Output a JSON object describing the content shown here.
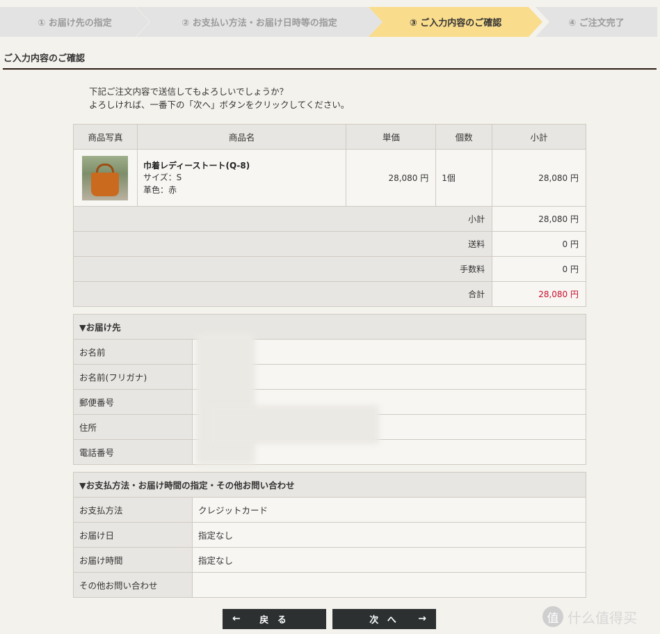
{
  "steps": [
    {
      "label": "① お届け先の指定",
      "active": false
    },
    {
      "label": "② お支払い方法・お届け日時等の指定",
      "active": false
    },
    {
      "label": "③ ご入力内容のご確認",
      "active": true
    },
    {
      "label": "④ ご注文完了",
      "active": false
    }
  ],
  "page_title": "ご入力内容のご確認",
  "intro": {
    "line1": "下記ご注文内容で送信してもよろしいでしょうか？",
    "line2": "よろしければ、一番下の「次へ」ボタンをクリックしてください。"
  },
  "cart": {
    "headers": [
      "商品写真",
      "商品名",
      "単価",
      "個数",
      "小計"
    ],
    "item": {
      "image_alt": "巾着レディーストート",
      "name": "巾着レディーストート(Q-8)",
      "attr_size": "サイズ：S",
      "attr_color": "革色：赤",
      "unit_price": "28,080 円",
      "quantity": "1個",
      "subtotal": "28,080 円"
    },
    "summary": [
      {
        "label": "小計",
        "value": "28,080 円"
      },
      {
        "label": "送料",
        "value": "0 円"
      },
      {
        "label": "手数料",
        "value": "0 円"
      },
      {
        "label": "合計",
        "value": "28,080 円"
      }
    ]
  },
  "shipping": {
    "heading": "▼お届け先",
    "rows": [
      {
        "label": "お名前"
      },
      {
        "label": "お名前(フリガナ)"
      },
      {
        "label": "郵便番号"
      },
      {
        "label": "住所"
      },
      {
        "label": "電話番号"
      }
    ]
  },
  "payment": {
    "heading": "▼お支払方法・お届け時間の指定・その他お問い合わせ",
    "rows": [
      {
        "label": "お支払方法",
        "value": "クレジットカード"
      },
      {
        "label": "お届け日",
        "value": "指定なし"
      },
      {
        "label": "お届け時間",
        "value": "指定なし"
      },
      {
        "label": "その他お問い合わせ",
        "value": ""
      }
    ]
  },
  "buttons": {
    "back_label": "戻 る",
    "back_arrow": "←",
    "next_label": "次 へ",
    "next_arrow": "→"
  },
  "watermark": {
    "glyph": "值",
    "text": "什么值得买"
  },
  "colors": {
    "active_step": "#f9dc8c",
    "inactive_step": "#e3e3e3",
    "total_red": "#c8102e",
    "button_bg": "#2c3031"
  }
}
